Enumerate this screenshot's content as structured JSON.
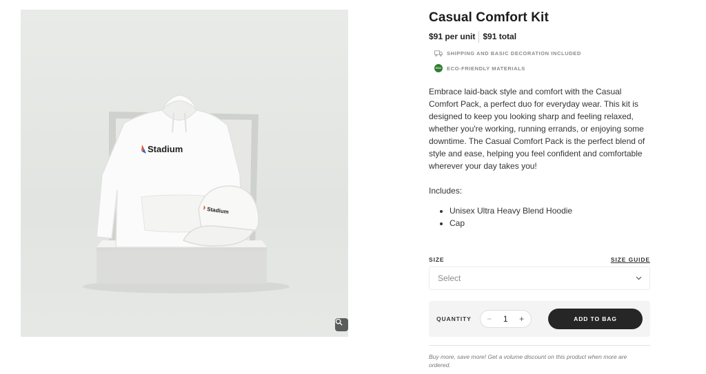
{
  "product": {
    "title": "Casual Comfort Kit",
    "price_per_unit": "$91 per unit",
    "price_total": "$91 total",
    "image_brand_text": "Stadium"
  },
  "features": [
    {
      "icon": "truck-icon",
      "text": "SHIPPING AND BASIC DECORATION INCLUDED"
    },
    {
      "icon": "eco-icon",
      "badge_text": "ECO",
      "text": "ECO-FRIENDLY MATERIALS"
    }
  ],
  "description": "Embrace laid-back style and comfort with the Casual Comfort Pack, a perfect duo for everyday wear. This kit is designed to keep you looking sharp and feeling relaxed, whether you're working, running errands, or enjoying some downtime. The Casual Comfort Pack is the perfect blend of style and ease, helping you feel confident and comfortable wherever your day takes you!",
  "includes": {
    "heading": "Includes:",
    "items": [
      "Unisex Ultra Heavy Blend Hoodie",
      "Cap"
    ]
  },
  "size": {
    "label": "SIZE",
    "guide_link": "SIZE GUIDE",
    "selected": "Select"
  },
  "quantity": {
    "label": "QUANTITY",
    "minus": "−",
    "value": "1",
    "plus": "+"
  },
  "cart": {
    "add_label": "ADD TO BAG"
  },
  "volume_note": "Buy more, save more! Get a volume discount on this product when more are ordered.",
  "colors": {
    "button_dark": "#262626",
    "eco_green": "#2e7d32",
    "image_background": "#e6e8e5"
  }
}
